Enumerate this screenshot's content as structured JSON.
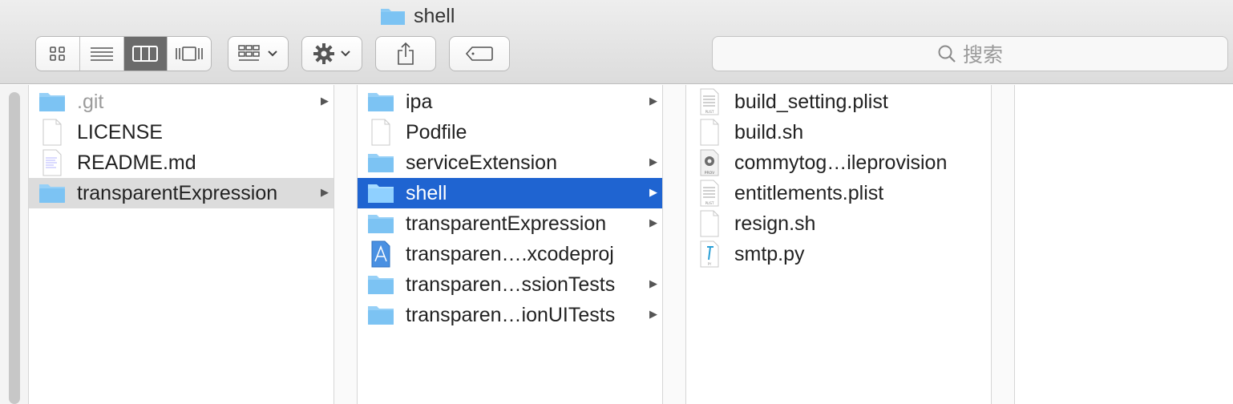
{
  "window": {
    "title": "shell"
  },
  "toolbar": {
    "view_buttons": [
      "icon-view",
      "list-view",
      "column-view",
      "gallery-view"
    ],
    "active_view": "column-view",
    "search_placeholder": "搜索"
  },
  "columns": [
    {
      "items": [
        {
          "name": ".git",
          "icon": "folder-icon",
          "has_children": true,
          "state": "dim"
        },
        {
          "name": "LICENSE",
          "icon": "document-icon",
          "has_children": false
        },
        {
          "name": "README.md",
          "icon": "text-document-icon",
          "has_children": false
        },
        {
          "name": "transparentExpression",
          "icon": "folder-icon",
          "has_children": true,
          "state": "selected-inactive"
        }
      ]
    },
    {
      "items": [
        {
          "name": "ipa",
          "icon": "folder-icon",
          "has_children": true
        },
        {
          "name": "Podfile",
          "icon": "document-icon",
          "has_children": false
        },
        {
          "name": "serviceExtension",
          "icon": "folder-icon",
          "has_children": true
        },
        {
          "name": "shell",
          "icon": "folder-icon",
          "has_children": true,
          "state": "selected"
        },
        {
          "name": "transparentExpression",
          "icon": "folder-icon",
          "has_children": true
        },
        {
          "name": "transparen….xcodeproj",
          "icon": "xcode-project-icon",
          "has_children": false
        },
        {
          "name": "transparen…ssionTests",
          "icon": "folder-icon",
          "has_children": true
        },
        {
          "name": "transparen…ionUITests",
          "icon": "folder-icon",
          "has_children": true
        }
      ]
    },
    {
      "items": [
        {
          "name": "build_setting.plist",
          "icon": "plist-icon",
          "has_children": false
        },
        {
          "name": "build.sh",
          "icon": "document-icon",
          "has_children": false
        },
        {
          "name": "commytog…ileprovision",
          "icon": "provision-icon",
          "has_children": false
        },
        {
          "name": "entitlements.plist",
          "icon": "plist-icon",
          "has_children": false
        },
        {
          "name": "resign.sh",
          "icon": "document-icon",
          "has_children": false
        },
        {
          "name": "smtp.py",
          "icon": "python-file-icon",
          "has_children": false
        }
      ]
    }
  ],
  "colors": {
    "selection_blue": "#1f64d1",
    "selection_grey": "#dcdcdc",
    "folder": "#7cc3f3"
  }
}
